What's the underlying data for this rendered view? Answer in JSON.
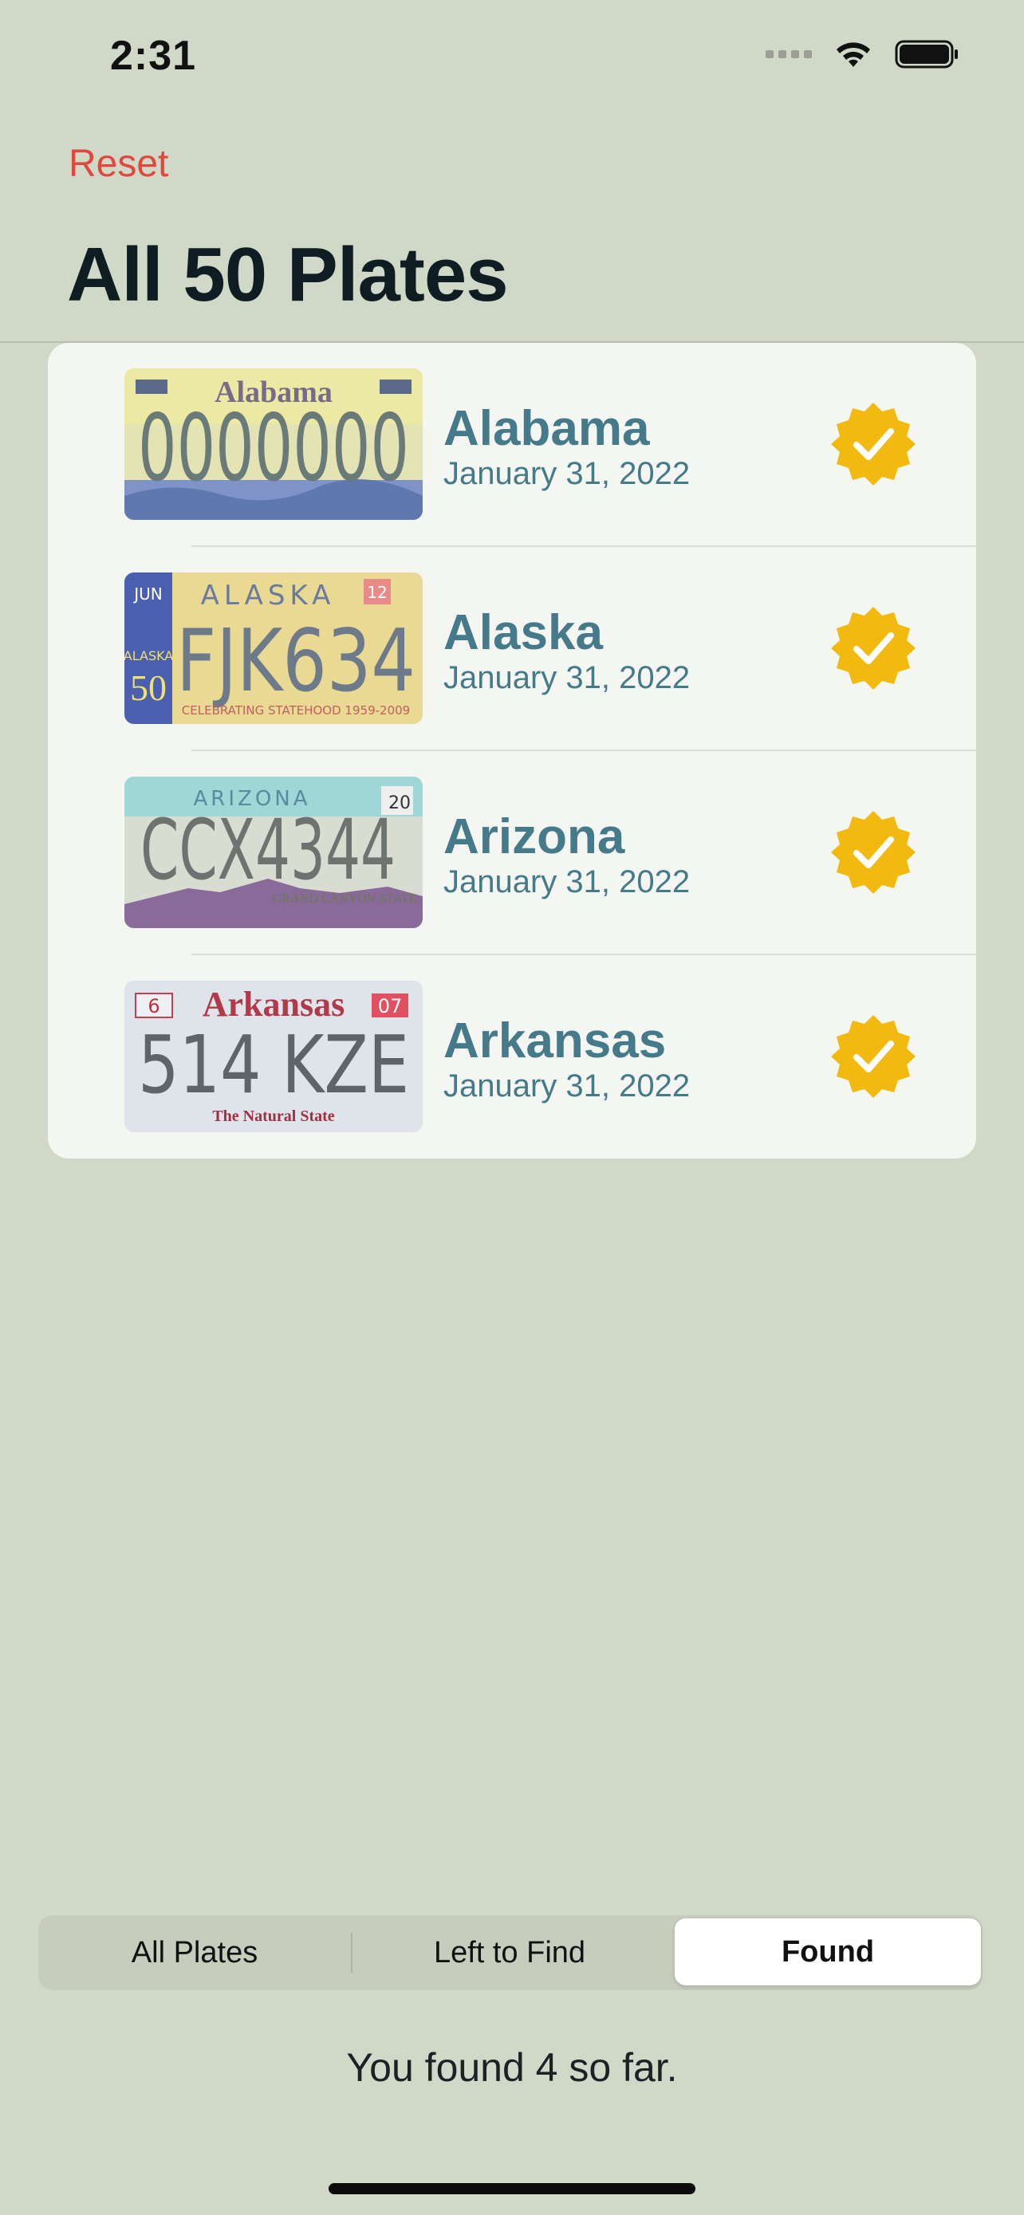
{
  "status_bar": {
    "time": "2:31"
  },
  "nav": {
    "reset_label": "Reset",
    "title": "All 50 Plates"
  },
  "plates": [
    {
      "state": "Alabama",
      "date": "January 31, 2022",
      "plate_text": "0000000",
      "plate_header": "Alabama",
      "found": true
    },
    {
      "state": "Alaska",
      "date": "January 31, 2022",
      "plate_text": "FJK634",
      "plate_header": "ALASKA",
      "plate_footer": "CELEBRATING STATEHOOD 1959-2009",
      "plate_month": "JUN",
      "plate_year": "12",
      "plate_side": "ALASKA",
      "plate_fifty": "50",
      "found": true
    },
    {
      "state": "Arizona",
      "date": "January 31, 2022",
      "plate_text": "CCX4344",
      "plate_header": "ARIZONA",
      "plate_footer": "GRAND CANYON STATE",
      "plate_year": "20",
      "found": true
    },
    {
      "state": "Arkansas",
      "date": "January 31, 2022",
      "plate_text": "514 KZE",
      "plate_header": "Arkansas",
      "plate_footer": "The Natural State",
      "plate_month": "6",
      "plate_year": "07",
      "found": true
    }
  ],
  "segments": {
    "all": "All Plates",
    "left": "Left to Find",
    "found": "Found",
    "selected": "Found"
  },
  "footer": {
    "found_text": "You found 4 so far."
  },
  "colors": {
    "accent": "#457a8a",
    "badge": "#f2b90f",
    "reset": "#e0483e",
    "background": "#d0d9c7"
  }
}
